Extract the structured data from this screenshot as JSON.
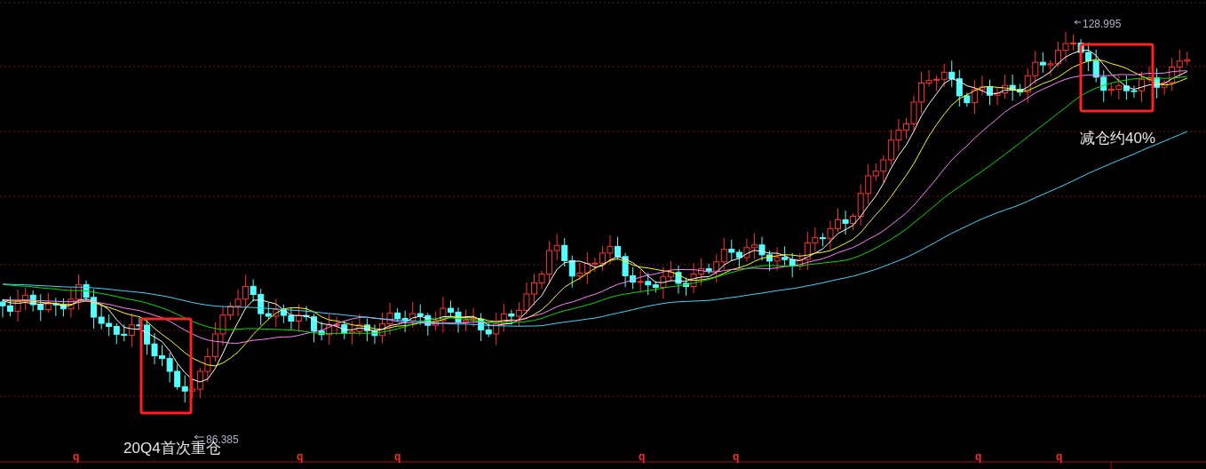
{
  "chart": {
    "high_label": "128.995",
    "low_label": "86.385"
  },
  "annotations": [
    {
      "text": "20Q4首次重仓"
    },
    {
      "text": "减仓约40%"
    }
  ],
  "markers": [
    "q",
    "q",
    "q",
    "q",
    "q",
    "q",
    "q"
  ]
}
